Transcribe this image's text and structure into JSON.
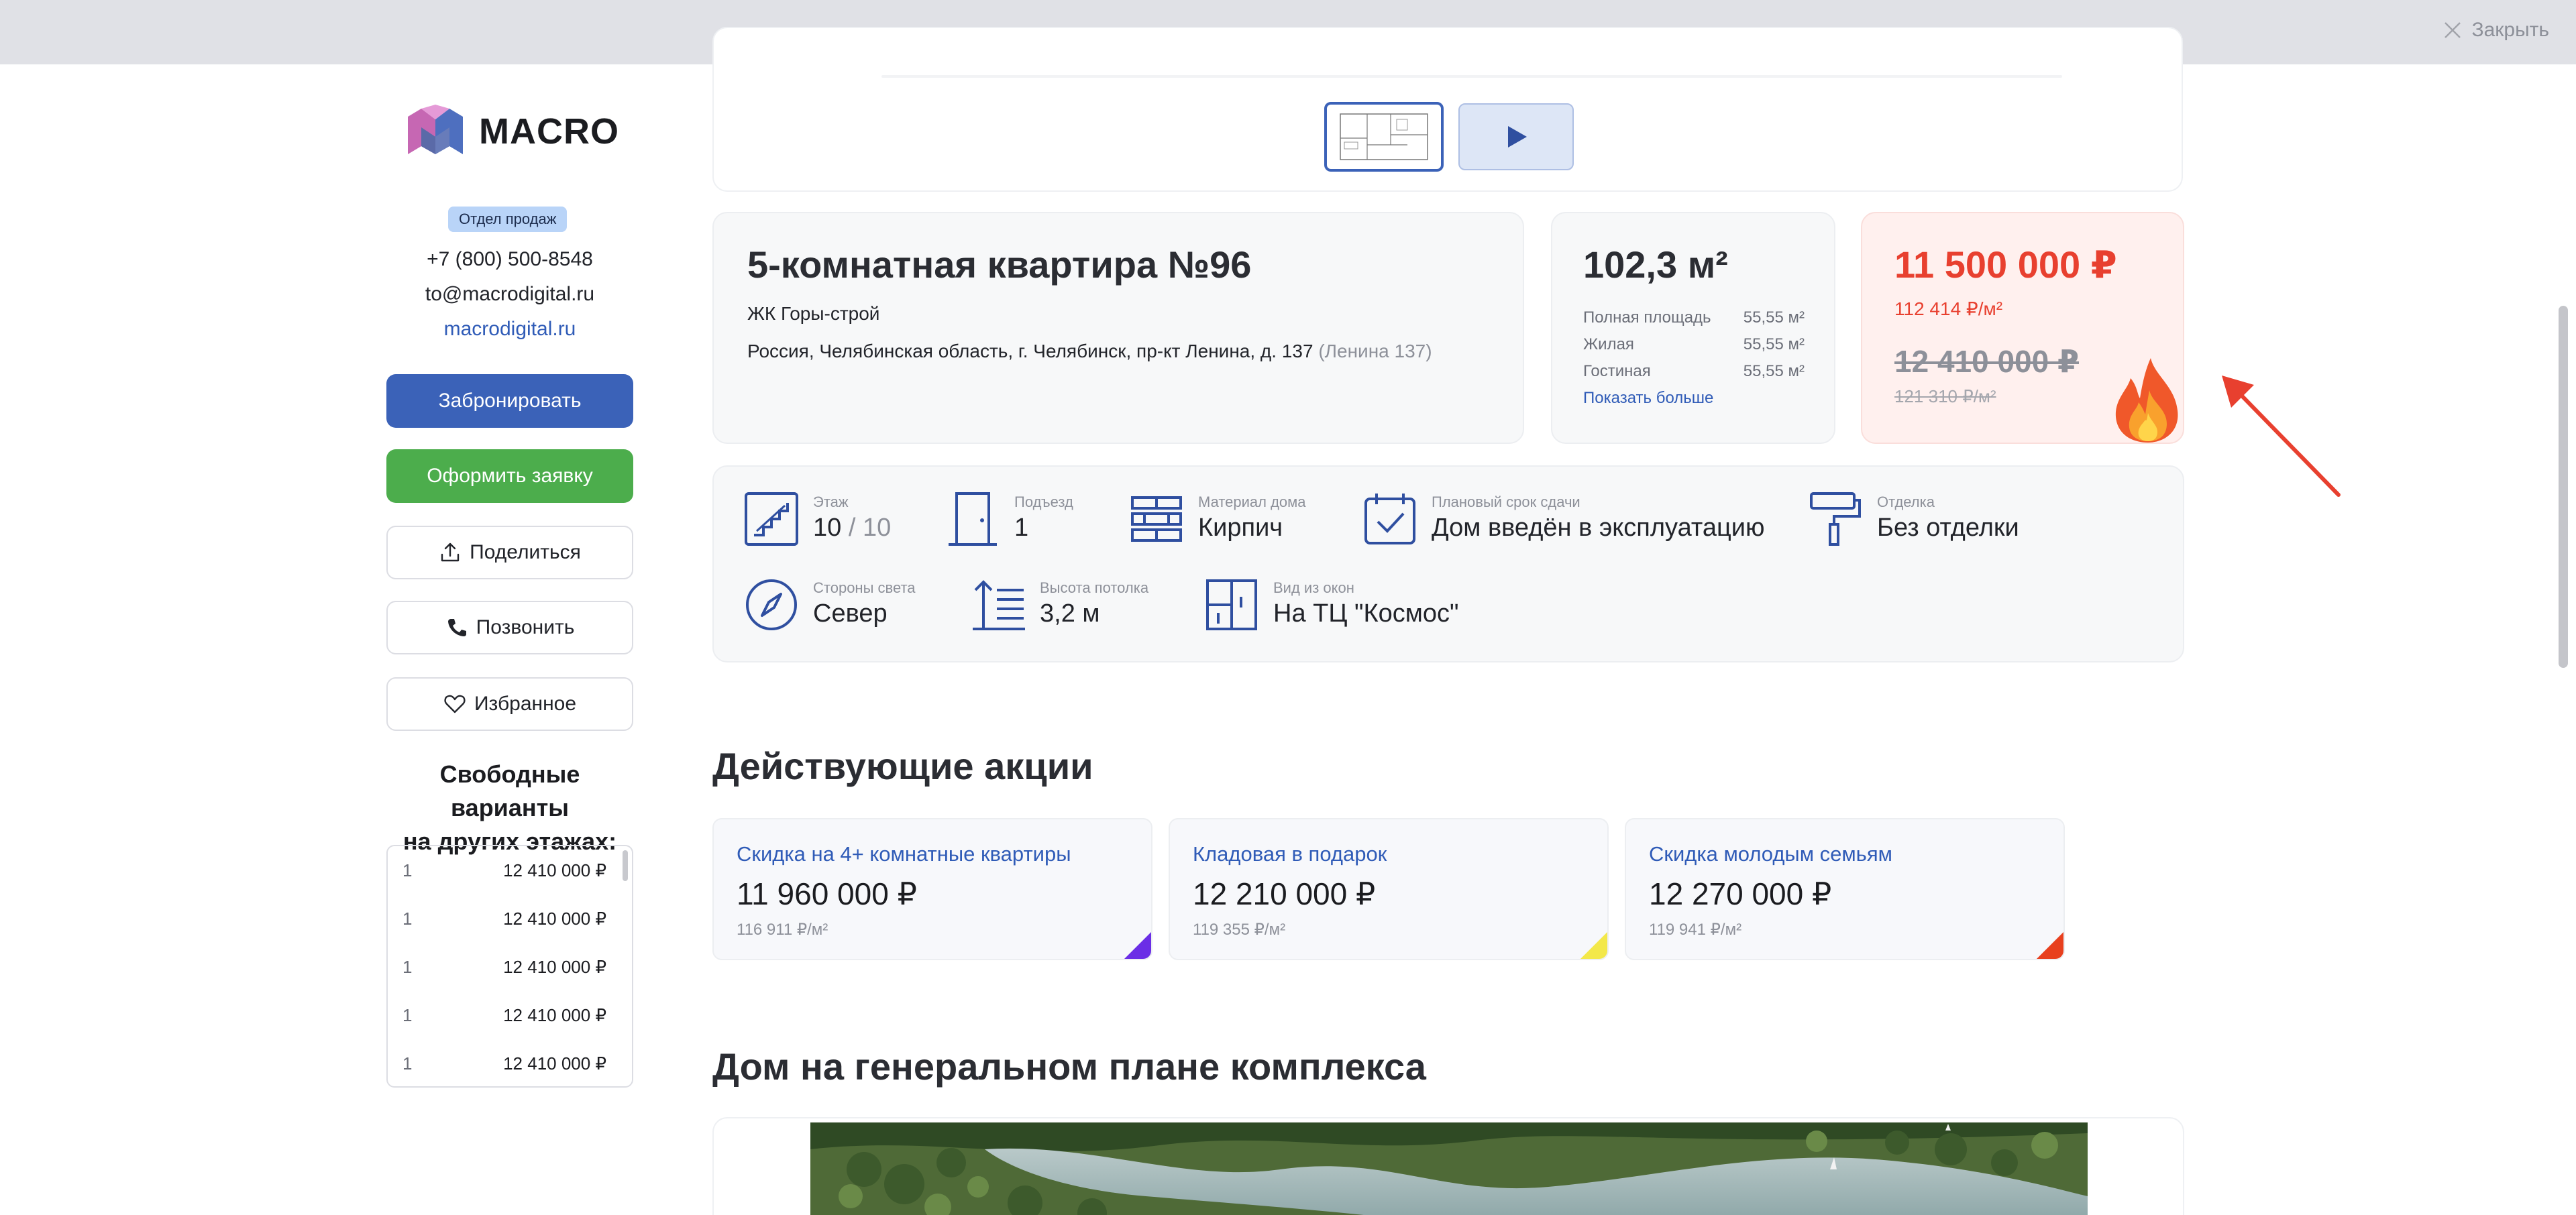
{
  "topbar": {
    "close_label": "Закрыть"
  },
  "sidebar": {
    "logo_text": "MACRO",
    "sales_badge": "Отдел продаж",
    "phone": "+7 (800) 500-8548",
    "email": "to@macrodigital.ru",
    "website": "macrodigital.ru",
    "buttons": {
      "book": "Забронировать",
      "request": "Оформить заявку",
      "share": "Поделиться",
      "call": "Позвонить",
      "favorite": "Избранное"
    },
    "other_floors_title_line1": "Свободные варианты",
    "other_floors_title_line2": "на других этажах:",
    "other_floors": [
      {
        "floor": "1",
        "price": "12 410 000 ₽"
      },
      {
        "floor": "1",
        "price": "12 410 000 ₽"
      },
      {
        "floor": "1",
        "price": "12 410 000 ₽"
      },
      {
        "floor": "1",
        "price": "12 410 000 ₽"
      },
      {
        "floor": "1",
        "price": "12 410 000 ₽"
      }
    ]
  },
  "apartment": {
    "title": "5-комнатная квартира №96",
    "complex": "ЖК Горы-строй",
    "address": "Россия, Челябинская область, г. Челябинск, пр-кт Ленина, д. 137",
    "address_short": "(Ленина 137)"
  },
  "area": {
    "total": "102,3 м²",
    "rows": [
      {
        "label": "Полная площадь",
        "value": "55,55 м²"
      },
      {
        "label": "Жилая",
        "value": "55,55 м²"
      },
      {
        "label": "Гостиная",
        "value": "55,55 м²"
      }
    ],
    "more_link": "Показать больше"
  },
  "price": {
    "current": "11 500 000 ₽",
    "current_per_m2": "112 414 ₽/м²",
    "old": "12 410 000 ₽",
    "old_per_m2": "121 310 ₽/м²"
  },
  "features": {
    "floor": {
      "label": "Этаж",
      "value": "10",
      "total": " / 10"
    },
    "entrance": {
      "label": "Подъезд",
      "value": "1"
    },
    "material": {
      "label": "Материал дома",
      "value": "Кирпич"
    },
    "deadline": {
      "label": "Плановый срок сдачи",
      "value": "Дом введён в эксплуатацию"
    },
    "finish": {
      "label": "Отделка",
      "value": "Без отделки"
    },
    "orientation": {
      "label": "Стороны света",
      "value": "Север"
    },
    "ceiling": {
      "label": "Высота потолка",
      "value": "3,2 м"
    },
    "view": {
      "label": "Вид из окон",
      "value": "На ТЦ \"Космос\""
    }
  },
  "promotions": {
    "title": "Действующие акции",
    "items": [
      {
        "name": "Скидка на 4+ комнатные квартиры",
        "price": "11 960 000 ₽",
        "per_m2": "116 911 ₽/м²",
        "color": "#6b2ee6"
      },
      {
        "name": "Кладовая в подарок",
        "price": "12 210 000 ₽",
        "per_m2": "119 355 ₽/м²",
        "color": "#f3e84a"
      },
      {
        "name": "Скидка молодым семьям",
        "price": "12 270 000 ₽",
        "per_m2": "119 941 ₽/м²",
        "color": "#e8401e"
      }
    ]
  },
  "genplan": {
    "title": "Дом на генеральном плане комплекса"
  },
  "colors": {
    "accent": "#3b62b8",
    "success": "#4cad4c",
    "price_red": "#e8402f",
    "link": "#2f5bb7"
  }
}
